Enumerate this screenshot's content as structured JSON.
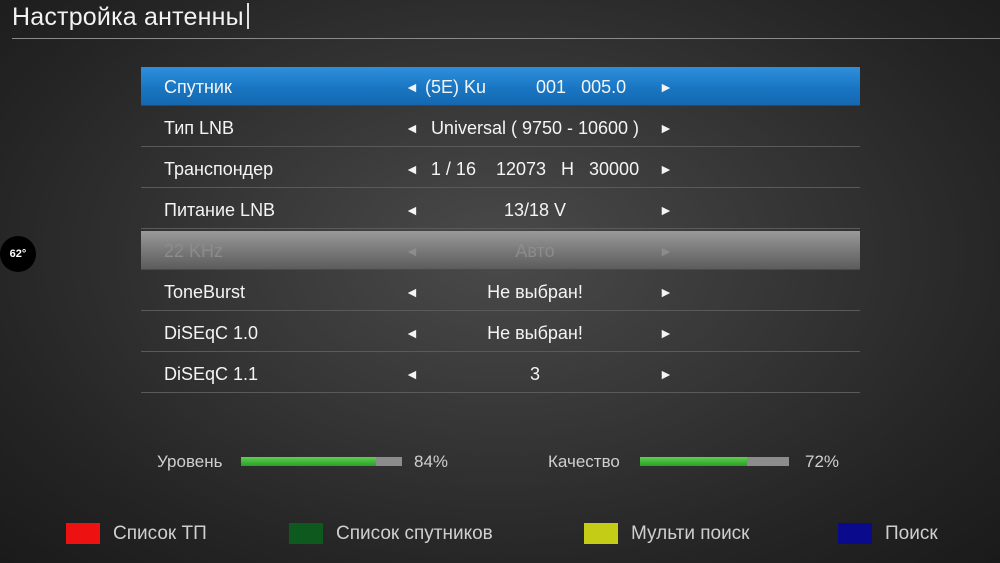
{
  "header": {
    "title": "Настройка антенны"
  },
  "temperature": "62°",
  "settings": [
    {
      "label": "Спутник",
      "value": "(5E) Ku          001   005.0",
      "state": "selected"
    },
    {
      "label": "Тип LNB",
      "value": "Universal ( 9750 - 10600 )",
      "state": "normal"
    },
    {
      "label": "Транспондер",
      "value": "1 / 16    12073   H   30000",
      "state": "normal"
    },
    {
      "label": "Питание LNB",
      "value": "13/18 V",
      "state": "normal"
    },
    {
      "label": "22 KHz",
      "value": "Авто",
      "state": "disabled"
    },
    {
      "label": "ToneBurst",
      "value": "Не выбран!",
      "state": "normal"
    },
    {
      "label": "DiSEqC 1.0",
      "value": "Не выбран!",
      "state": "normal"
    },
    {
      "label": "DiSEqC 1.1",
      "value": "3",
      "state": "normal"
    }
  ],
  "arrows": {
    "left": "◄",
    "right": "►"
  },
  "signal": {
    "level": {
      "label": "Уровень",
      "value_text": "84%",
      "fraction": 0.84
    },
    "quality": {
      "label": "Качество",
      "value_text": "72%",
      "fraction": 0.72
    }
  },
  "color_keys": [
    {
      "label": "Список ТП",
      "color": "#ee1111"
    },
    {
      "label": "Список спутников",
      "color": "#0e5a1e"
    },
    {
      "label": "Мульти поиск",
      "color": "#c4cc16"
    },
    {
      "label": "Поиск",
      "color": "#0a0a8c"
    }
  ]
}
